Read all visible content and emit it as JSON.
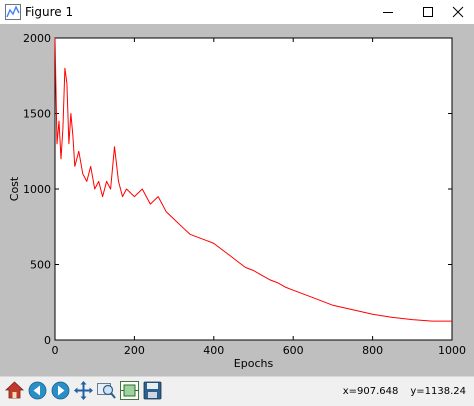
{
  "window": {
    "title": "Figure 1",
    "icons": [
      "figure-app-icon",
      "minimize-icon",
      "maximize-icon",
      "close-icon"
    ]
  },
  "toolbar": {
    "tools": [
      "home-icon",
      "back-icon",
      "forward-icon",
      "pan-icon",
      "zoom-icon",
      "configure-subplots-icon",
      "save-icon"
    ],
    "coords": {
      "x": "x=907.648",
      "y": "y=1138.24"
    }
  },
  "chart_data": {
    "type": "line",
    "title": "",
    "xlabel": "Epochs",
    "ylabel": "Cost",
    "xlim": [
      0,
      1000
    ],
    "ylim": [
      0,
      2000
    ],
    "xticks": [
      "0",
      "200",
      "400",
      "600",
      "800",
      "1000"
    ],
    "yticks": [
      "0",
      "500",
      "1000",
      "1500",
      "2000"
    ],
    "grid": false,
    "series": [
      {
        "color": "#ff0000",
        "x": [
          0,
          5,
          10,
          15,
          20,
          25,
          30,
          35,
          40,
          45,
          50,
          60,
          70,
          80,
          90,
          100,
          110,
          120,
          130,
          140,
          150,
          160,
          170,
          180,
          200,
          220,
          240,
          260,
          280,
          300,
          320,
          340,
          360,
          380,
          400,
          420,
          440,
          460,
          480,
          500,
          520,
          540,
          560,
          580,
          600,
          650,
          700,
          750,
          800,
          850,
          900,
          950,
          1000
        ],
        "y": [
          2000,
          1300,
          1450,
          1200,
          1400,
          1800,
          1700,
          1300,
          1500,
          1350,
          1150,
          1250,
          1100,
          1050,
          1150,
          1000,
          1050,
          950,
          1050,
          1000,
          1280,
          1050,
          950,
          1000,
          950,
          1000,
          900,
          950,
          850,
          800,
          750,
          700,
          680,
          660,
          640,
          600,
          560,
          520,
          480,
          460,
          430,
          400,
          380,
          350,
          330,
          280,
          230,
          200,
          170,
          150,
          135,
          125,
          125
        ]
      }
    ]
  }
}
